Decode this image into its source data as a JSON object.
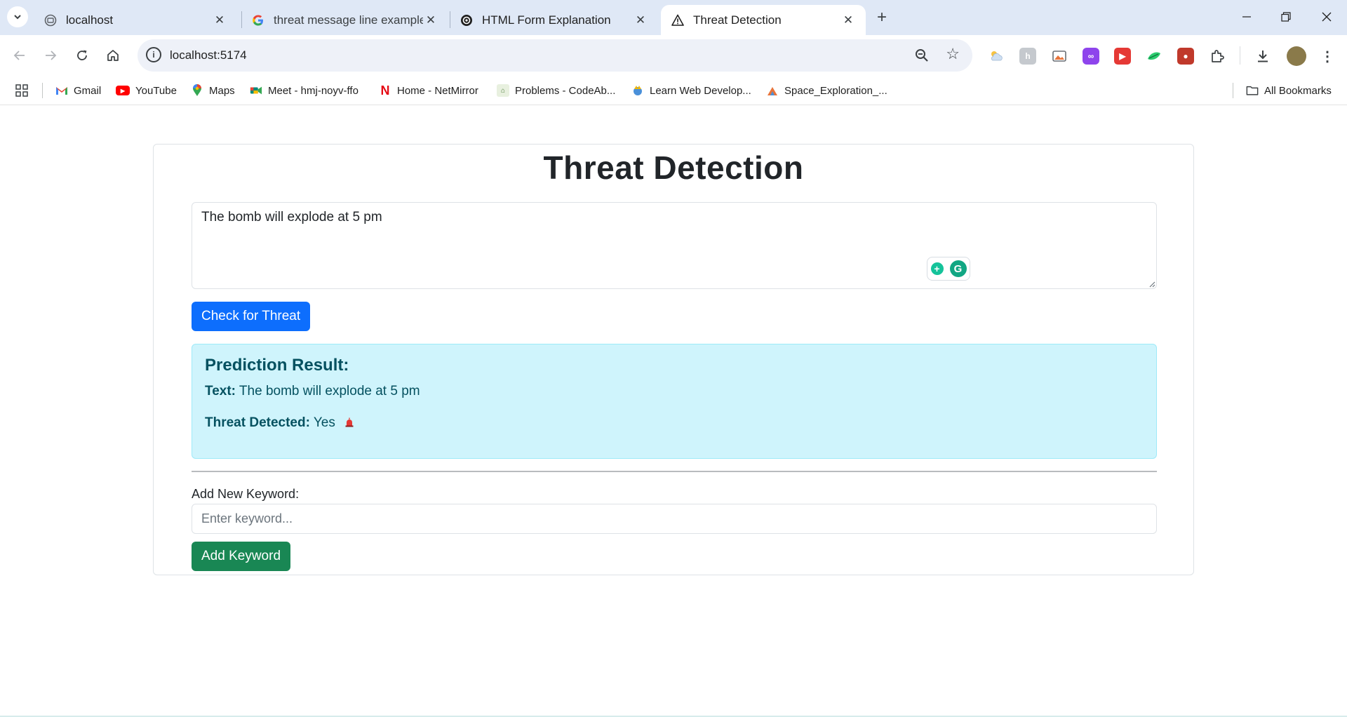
{
  "browser": {
    "tabs": [
      {
        "title": "localhost",
        "icon": "globe-icon",
        "active": false
      },
      {
        "title": "threat message line example in",
        "icon": "google-icon",
        "active": false
      },
      {
        "title": "HTML Form Explanation",
        "icon": "chatgpt-icon",
        "active": false
      },
      {
        "title": "Threat Detection",
        "icon": "warning-icon",
        "active": true
      }
    ],
    "url": "localhost:5174",
    "bookmarks": [
      {
        "label": "Gmail",
        "icon": "gmail-icon",
        "color": "#ea4335"
      },
      {
        "label": "YouTube",
        "icon": "youtube-icon",
        "color": "#ff0000"
      },
      {
        "label": "Maps",
        "icon": "maps-icon",
        "color": "#34a853"
      },
      {
        "label": "Meet - hmj-noyv-ffo",
        "icon": "meet-icon",
        "color": "#00897b"
      },
      {
        "label": "Home - NetMirror",
        "icon": "netmirror-icon",
        "color": "#e50914"
      },
      {
        "label": "Problems - CodeAb...",
        "icon": "codeabbey-icon",
        "color": "#4a7c3a"
      },
      {
        "label": "Learn Web Develop...",
        "icon": "mdn-icon",
        "color": "#f2b705"
      },
      {
        "label": "Space_Exploration_...",
        "icon": "space-icon",
        "color": "#e8743b"
      }
    ],
    "all_bookmarks_label": "All Bookmarks"
  },
  "page": {
    "title": "Threat Detection",
    "message_value": "The bomb will explode at 5 pm",
    "check_button_label": "Check for Threat",
    "result": {
      "heading": "Prediction Result:",
      "text_label": "Text:",
      "text_value": "The bomb will explode at 5 pm",
      "threat_label": "Threat Detected:",
      "threat_value": "Yes"
    },
    "keyword": {
      "label": "Add New Keyword:",
      "placeholder": "Enter keyword...",
      "button_label": "Add Keyword"
    }
  },
  "colors": {
    "primary": "#0d6efd",
    "success": "#198754",
    "info_bg": "#cff4fc",
    "info_text": "#055160"
  }
}
